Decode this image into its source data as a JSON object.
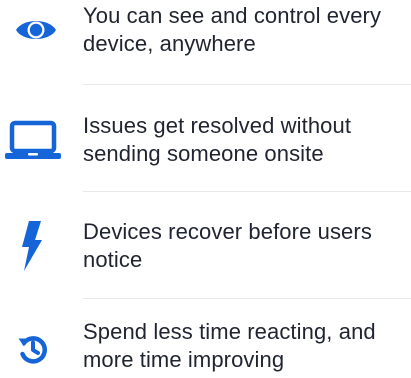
{
  "theme": {
    "accent": "#1565d8",
    "text": "#1f2430",
    "divider": "#e6e8ec"
  },
  "features": [
    {
      "icon": "eye-icon",
      "text": "You can see and control every device, anywhere"
    },
    {
      "icon": "laptop-icon",
      "text": "Issues get resolved without sending someone onsite"
    },
    {
      "icon": "lightning-bolt-icon",
      "text": "Devices recover before users notice"
    },
    {
      "icon": "history-clock-icon",
      "text": "Spend less time reacting, and more time improving"
    }
  ]
}
